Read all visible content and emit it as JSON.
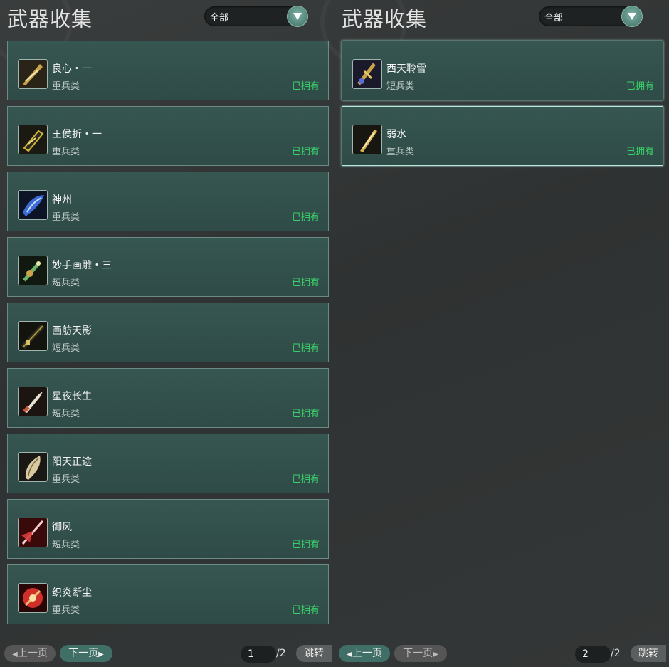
{
  "panels": [
    {
      "title": "武器收集",
      "filter": "全部",
      "items": [
        {
          "name": "良心・一",
          "cat": "重兵类",
          "status": "已拥有",
          "color": "#c9a24a"
        },
        {
          "name": "王侯折・一",
          "cat": "重兵类",
          "status": "已拥有",
          "color": "#d4b43a"
        },
        {
          "name": "神州",
          "cat": "重兵类",
          "status": "已拥有",
          "color": "#3b6bd6"
        },
        {
          "name": "妙手画雕・三",
          "cat": "短兵类",
          "status": "已拥有",
          "color": "#6fb36a"
        },
        {
          "name": "画舫天影",
          "cat": "短兵类",
          "status": "已拥有",
          "color": "#b59a3a"
        },
        {
          "name": "星夜长生",
          "cat": "短兵类",
          "status": "已拥有",
          "color": "#c95a3a"
        },
        {
          "name": "阳天正途",
          "cat": "重兵类",
          "status": "已拥有",
          "color": "#d9c9a0"
        },
        {
          "name": "御风",
          "cat": "短兵类",
          "status": "已拥有",
          "color": "#d83a3a"
        },
        {
          "name": "织炎断尘",
          "cat": "重兵类",
          "status": "已拥有",
          "color": "#d0302a"
        }
      ],
      "prev": "上一页",
      "next": "下一页",
      "page": "1",
      "total": "/2",
      "jump": "跳转"
    },
    {
      "title": "武器收集",
      "filter": "全部",
      "items": [
        {
          "name": "西天聆雪",
          "cat": "短兵类",
          "status": "已拥有",
          "color": "#c9a24a"
        },
        {
          "name": "弱水",
          "cat": "重兵类",
          "status": "已拥有",
          "color": "#d9b55a"
        }
      ],
      "prev": "上一页",
      "next": "下一页",
      "page": "2",
      "total": "/2",
      "jump": "跳转"
    }
  ]
}
